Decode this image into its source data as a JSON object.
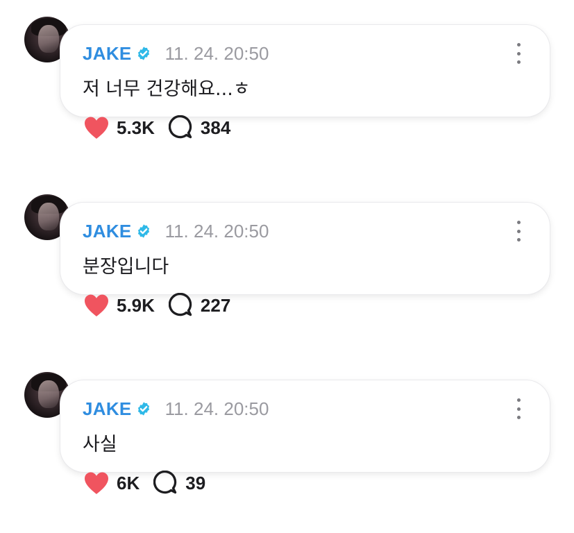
{
  "posts": [
    {
      "author": "JAKE",
      "timestamp": "11. 24. 20:50",
      "text": "저 너무 건강해요...ㅎ",
      "likes": "5.3K",
      "comments": "384"
    },
    {
      "author": "JAKE",
      "timestamp": "11. 24. 20:50",
      "text": "분장입니다",
      "likes": "5.9K",
      "comments": "227"
    },
    {
      "author": "JAKE",
      "timestamp": "11. 24. 20:50",
      "text": "사실",
      "likes": "6K",
      "comments": "39"
    }
  ],
  "icons": {
    "verified": "verified-badge-icon",
    "like": "heart-icon",
    "comment": "speech-bubble-icon",
    "more": "more-vertical-icon"
  },
  "colors": {
    "author": "#2f8de0",
    "verified": "#2fb9e8",
    "heart": "#f0545f",
    "timestamp": "#9a9aa0"
  }
}
